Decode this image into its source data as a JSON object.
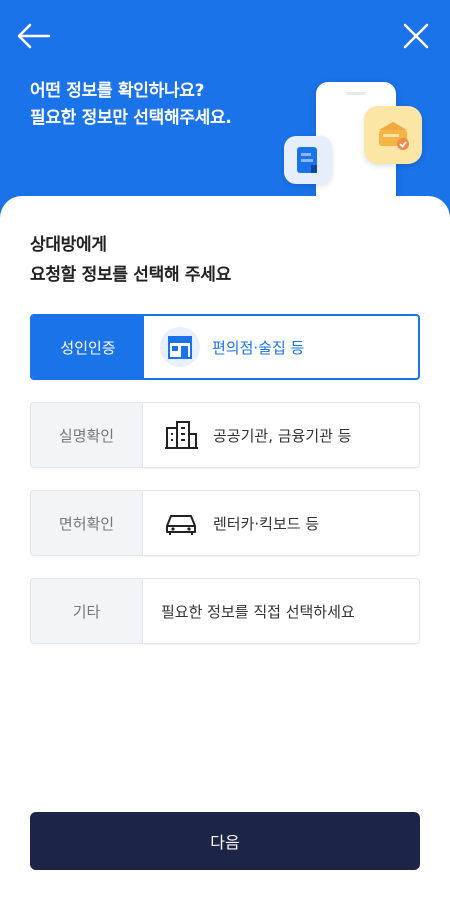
{
  "header": {
    "title_line1": "어떤 정보를 확인하나요?",
    "title_line2": "필요한 정보만 선택해주세요."
  },
  "sheet": {
    "title_line1": "상대방에게",
    "title_line2": "요청할 정보를 선택해 주세요"
  },
  "options": [
    {
      "label": "성인인증",
      "desc": "편의점·술집 등",
      "icon": "store-icon",
      "selected": true
    },
    {
      "label": "실명확인",
      "desc": "공공기관, 금융기관 등",
      "icon": "building-icon",
      "selected": false
    },
    {
      "label": "면허확인",
      "desc": "렌터카·킥보드 등",
      "icon": "car-icon",
      "selected": false
    },
    {
      "label": "기타",
      "desc": "필요한 정보를 직접 선택하세요",
      "icon": "",
      "selected": false
    }
  ],
  "next_label": "다음",
  "colors": {
    "primary": "#1a73e8",
    "button": "#1c2448"
  }
}
